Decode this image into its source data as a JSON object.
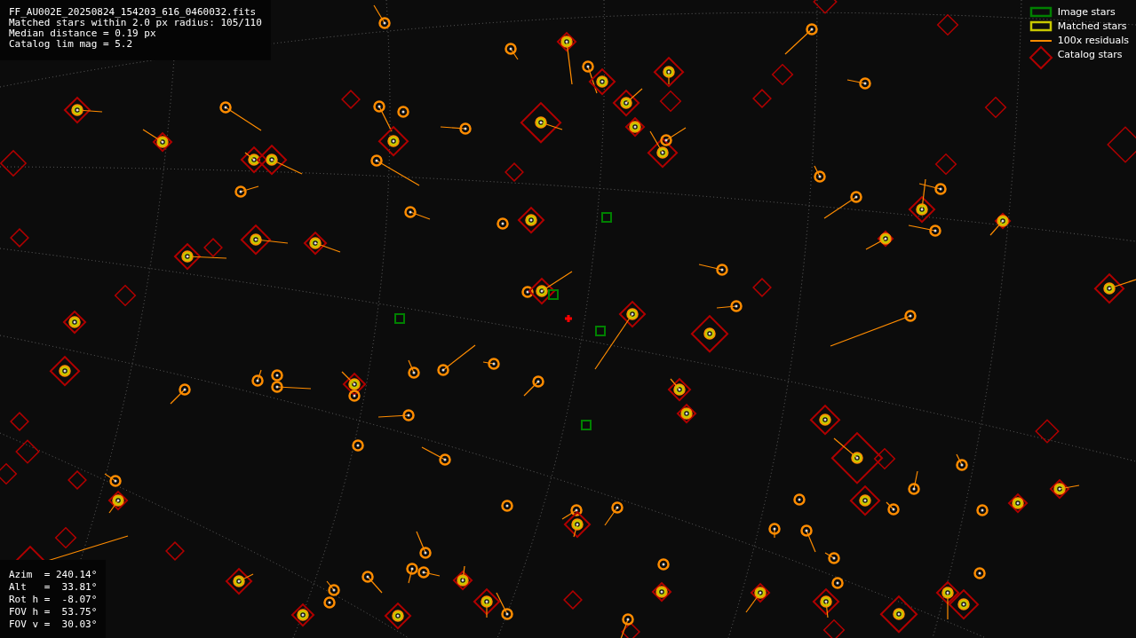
{
  "info_lines": [
    "FF_AU002E_20250824_154203_616_0460032.fits",
    "Matched stars within 2.0 px radius: 105/110",
    "Median distance = 0.19 px",
    "Catalog lim mag = 5.2"
  ],
  "legend": [
    {
      "kind": "image",
      "label": "Image stars",
      "color": "#008000"
    },
    {
      "kind": "matched",
      "label": "Matched stars",
      "color": "#c8c800"
    },
    {
      "kind": "residual",
      "label": "100x residuals",
      "color": "#ff8c00"
    },
    {
      "kind": "catalog",
      "label": "Catalog stars",
      "color": "#b00000"
    }
  ],
  "pointing": [
    "Azim  = 240.14°",
    "Alt   =  33.81°",
    "Rot h =  -8.07°",
    "FOV h =  53.75°",
    "FOV v =  30.03°"
  ]
}
